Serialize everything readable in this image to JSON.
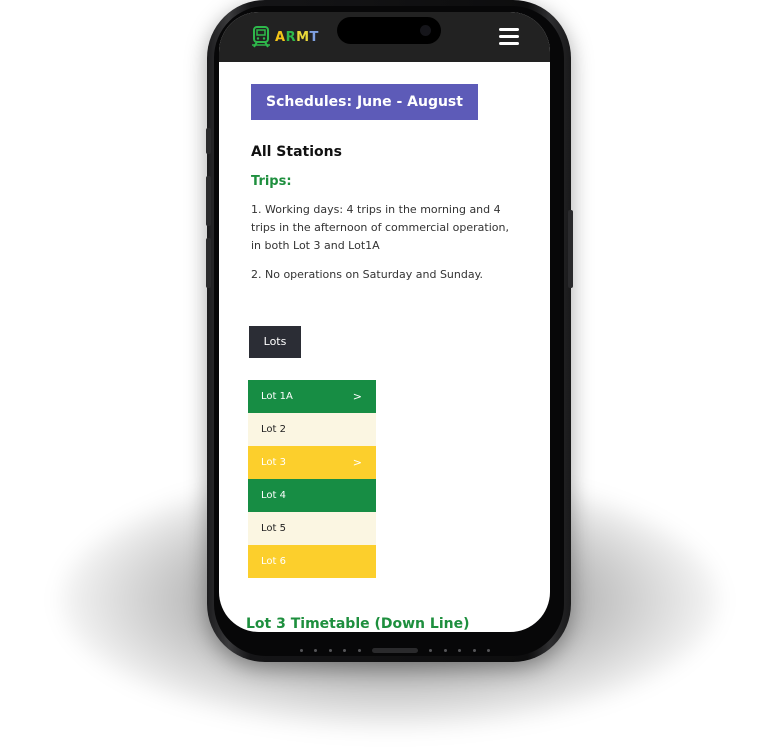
{
  "header": {
    "logo_text_a": "A",
    "logo_text_r": "R",
    "logo_text_m": "M",
    "logo_text_t": "T"
  },
  "icons": {
    "logo": "train-icon",
    "menu": "hamburger-menu-icon",
    "expand": "chevron-right-icon"
  },
  "main": {
    "banner": "Schedules: June - August",
    "section_title": "All Stations",
    "trips_label": "Trips:",
    "trip_items": [
      "1. Working days: 4 trips in the morning and 4 trips in the afternoon of commercial operation, in both Lot 3 and Lot1A",
      "2. No operations on Saturday and Sunday."
    ],
    "lots_button": "Lots",
    "lots": [
      {
        "label": "Lot 1A",
        "chevron": ">"
      },
      {
        "label": "Lot 2",
        "chevron": ""
      },
      {
        "label": "Lot 3",
        "chevron": ">"
      },
      {
        "label": "Lot 4",
        "chevron": ""
      },
      {
        "label": "Lot 5",
        "chevron": ""
      },
      {
        "label": "Lot 6",
        "chevron": ""
      }
    ],
    "timetable_heading": "Lot 3 Timetable (Down Line)"
  },
  "colors": {
    "banner_bg": "#5d5bb8",
    "header_bg": "#222222",
    "accent_green": "#1e8f3e",
    "lot_green": "#178d44",
    "lot_cream": "#fbf6e2",
    "lot_yellow": "#fccf2c",
    "lots_button_bg": "#2b2d35"
  }
}
